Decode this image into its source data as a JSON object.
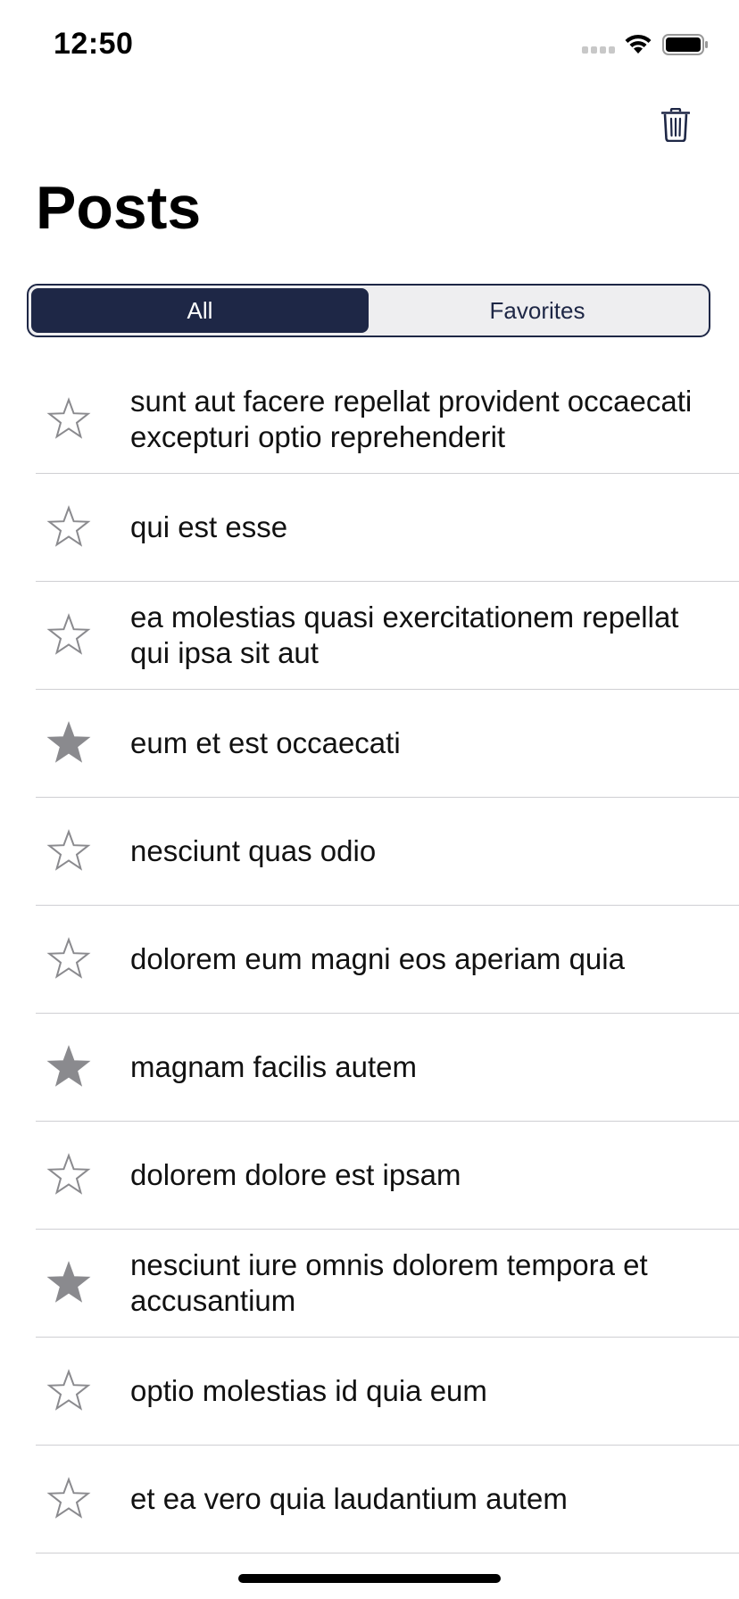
{
  "status_bar": {
    "time": "12:50"
  },
  "header": {
    "title": "Posts",
    "trash_icon": "trash-icon"
  },
  "segments": [
    {
      "label": "All",
      "selected": true
    },
    {
      "label": "Favorites",
      "selected": false
    }
  ],
  "colors": {
    "accent": "#1e2746",
    "star_gray": "#8a8a8e",
    "divider": "#cfcfd3"
  },
  "posts": [
    {
      "title": "sunt aut facere repellat provident occaecati excepturi optio reprehenderit",
      "favorite": false
    },
    {
      "title": "qui est esse",
      "favorite": false
    },
    {
      "title": "ea molestias quasi exercitationem repellat qui ipsa sit aut",
      "favorite": false
    },
    {
      "title": "eum et est occaecati",
      "favorite": true
    },
    {
      "title": "nesciunt quas odio",
      "favorite": false
    },
    {
      "title": "dolorem eum magni eos aperiam quia",
      "favorite": false
    },
    {
      "title": "magnam facilis autem",
      "favorite": true
    },
    {
      "title": "dolorem dolore est ipsam",
      "favorite": false
    },
    {
      "title": "nesciunt iure omnis dolorem tempora et accusantium",
      "favorite": true
    },
    {
      "title": "optio molestias id quia eum",
      "favorite": false
    },
    {
      "title": "et ea vero quia laudantium autem",
      "favorite": false
    }
  ]
}
